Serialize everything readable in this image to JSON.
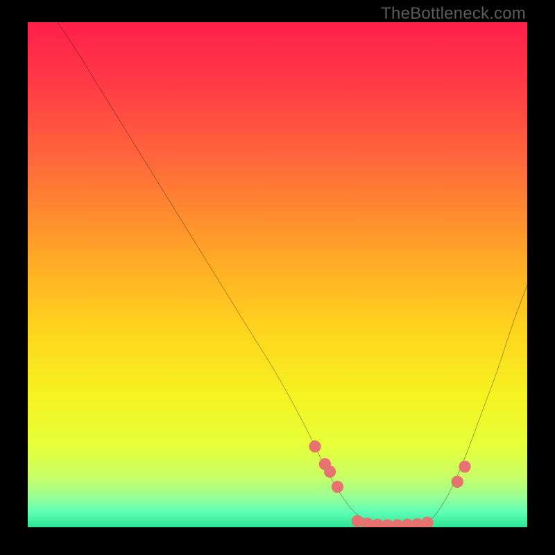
{
  "watermark": "TheBottleneck.com",
  "colors": {
    "black": "#000000",
    "curve": "#000000",
    "dot": "#e6736f"
  },
  "chart_data": {
    "type": "line",
    "title": "",
    "xlabel": "",
    "ylabel": "",
    "xlim": [
      0,
      100
    ],
    "ylim": [
      0,
      100
    ],
    "gradient_stops": [
      {
        "offset": 0.0,
        "color": "#ff1f4b"
      },
      {
        "offset": 0.12,
        "color": "#ff3a46"
      },
      {
        "offset": 0.28,
        "color": "#ff6a3a"
      },
      {
        "offset": 0.45,
        "color": "#ffa328"
      },
      {
        "offset": 0.6,
        "color": "#ffd21e"
      },
      {
        "offset": 0.74,
        "color": "#f6f321"
      },
      {
        "offset": 0.84,
        "color": "#e6ff3a"
      },
      {
        "offset": 0.9,
        "color": "#c8ff67"
      },
      {
        "offset": 0.94,
        "color": "#99ff95"
      },
      {
        "offset": 0.97,
        "color": "#5dffb5"
      },
      {
        "offset": 1.0,
        "color": "#2fe493"
      }
    ],
    "series": [
      {
        "name": "bottleneck-curve",
        "x": [
          6,
          10,
          15,
          20,
          25,
          30,
          35,
          40,
          45,
          50,
          55,
          58,
          60,
          63,
          66,
          70,
          74,
          78,
          80,
          82,
          85,
          88,
          91,
          94,
          97,
          100
        ],
        "y": [
          100,
          94,
          86,
          78,
          70,
          62,
          54,
          46,
          38,
          30,
          21,
          15,
          11,
          6,
          2.5,
          0.7,
          0.3,
          0.4,
          1.0,
          3,
          8,
          15,
          23,
          31,
          40,
          48
        ]
      }
    ],
    "dots": {
      "name": "highlight-dots",
      "x": [
        57.5,
        59.5,
        60.5,
        62,
        66,
        68,
        70,
        72,
        74,
        76,
        78,
        80,
        86,
        87.5
      ],
      "y": [
        16,
        12.5,
        11,
        8,
        1.2,
        0.7,
        0.5,
        0.4,
        0.4,
        0.5,
        0.6,
        0.9,
        9,
        12
      ],
      "r": 1.2
    }
  }
}
